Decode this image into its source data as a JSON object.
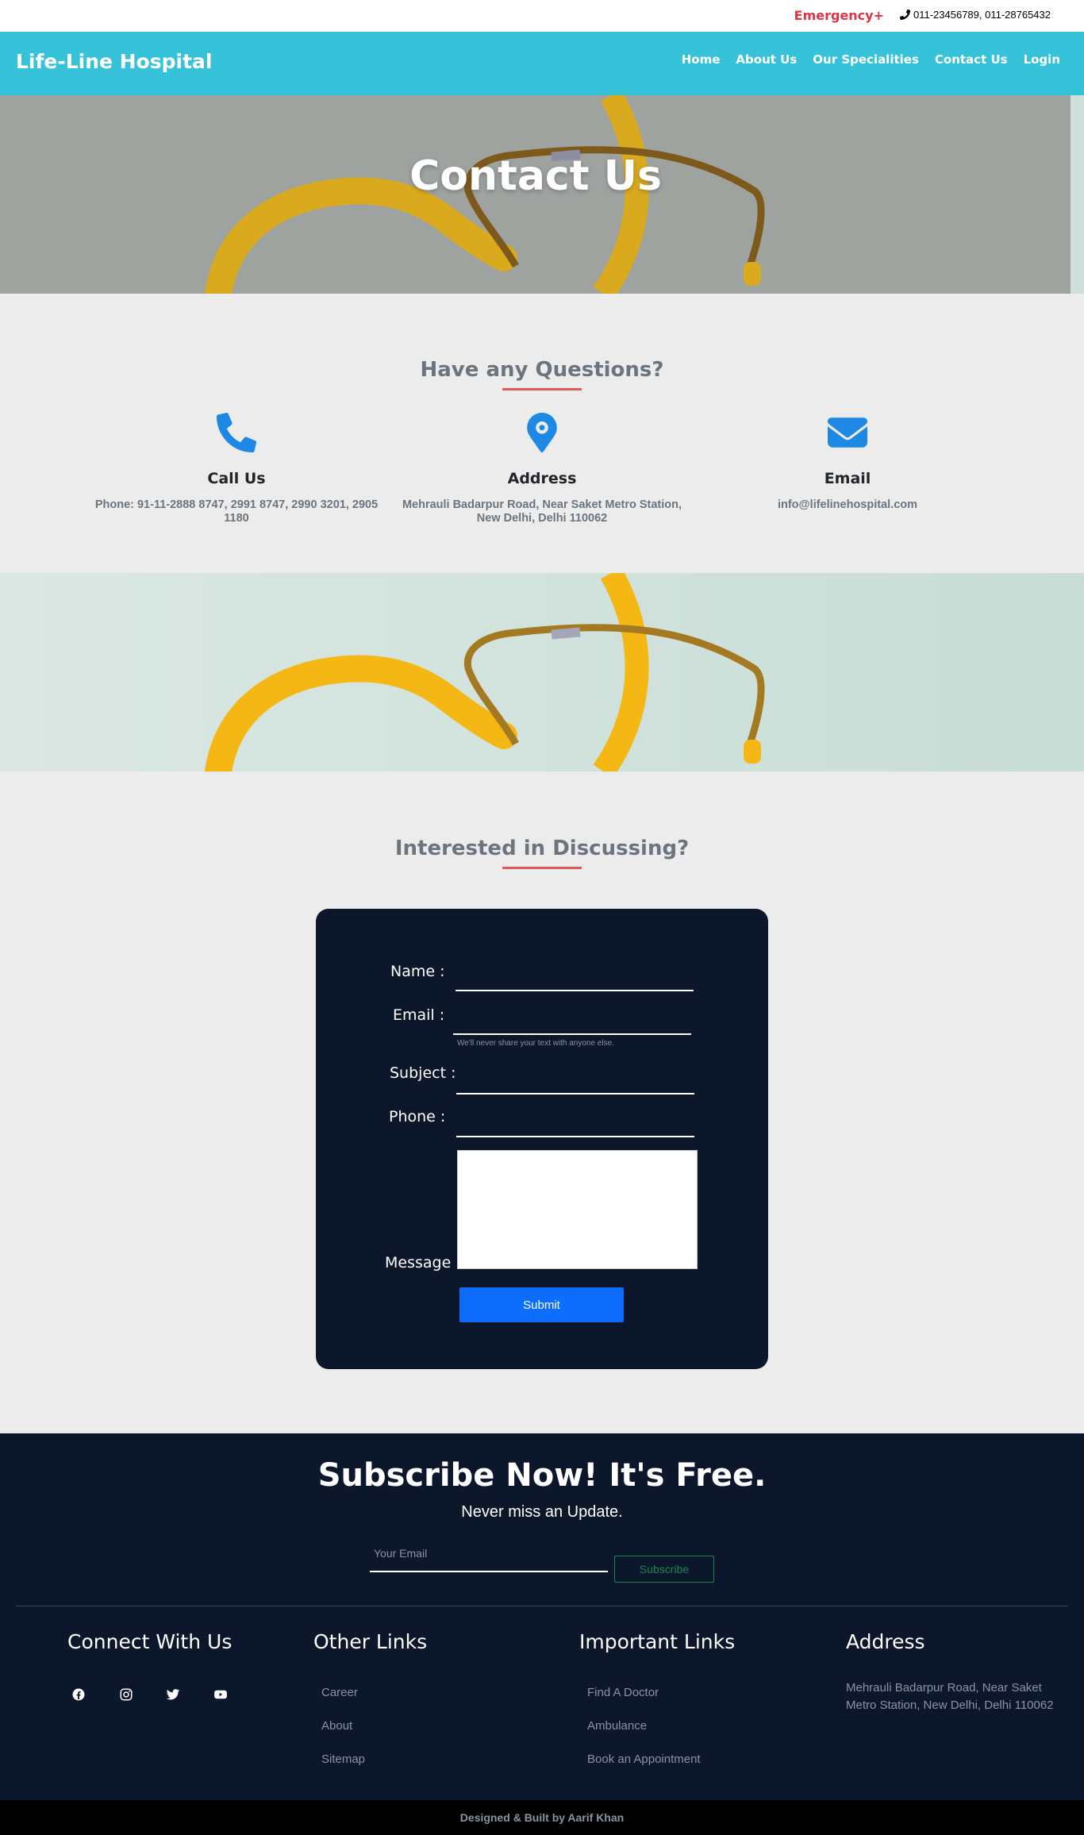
{
  "topbar": {
    "emergency": "Emergency+",
    "phones": "011-23456789, 011-28765432"
  },
  "nav": {
    "brand": "Life-Line Hospital",
    "links": [
      "Home",
      "About Us",
      "Our Specialities",
      "Contact Us",
      "Login"
    ]
  },
  "hero": {
    "title": "Contact Us"
  },
  "questions": {
    "title": "Have any Questions?",
    "items": [
      {
        "icon": "phone-icon",
        "heading": "Call Us",
        "text": "Phone: 91-11-2888 8747, 2991 8747, 2990 3201, 2905 1180"
      },
      {
        "icon": "map-pin-icon",
        "heading": "Address",
        "text": "Mehrauli Badarpur Road, Near Saket Metro Station, New Delhi, Delhi 110062"
      },
      {
        "icon": "envelope-icon",
        "heading": "Email",
        "text": "info@lifelinehospital.com"
      }
    ]
  },
  "discuss": {
    "title": "Interested in Discussing?",
    "form": {
      "name_label": "Name :",
      "email_label": "Email :",
      "email_hint": "We'll never share your text with anyone else.",
      "subject_label": "Subject :",
      "phone_label": "Phone :",
      "message_label": "Message :",
      "submit": "Submit"
    }
  },
  "subscribe": {
    "title": "Subscribe Now! It's Free.",
    "tagline": "Never miss an Update.",
    "placeholder": "Your Email",
    "button": "Subscribe"
  },
  "footer": {
    "connect_title": "Connect With Us",
    "social_icons": [
      "facebook-icon",
      "instagram-icon",
      "twitter-icon",
      "youtube-icon"
    ],
    "other_title": "Other Links",
    "other_links": [
      "Career",
      "About",
      "Sitemap"
    ],
    "important_title": "Important Links",
    "important_links": [
      "Find A Doctor",
      "Ambulance",
      "Book an Appointment"
    ],
    "address_title": "Address",
    "address": "Mehrauli Badarpur Road, Near Saket Metro Station, New Delhi, Delhi 110062",
    "credit": "Designed & Built by Aarif Khan"
  },
  "colors": {
    "nav": "#36c3d9",
    "navy": "#0c172c",
    "accent_blue": "#1e88e5",
    "emergency_red": "#dc3545",
    "underline": "#e05a5a"
  }
}
